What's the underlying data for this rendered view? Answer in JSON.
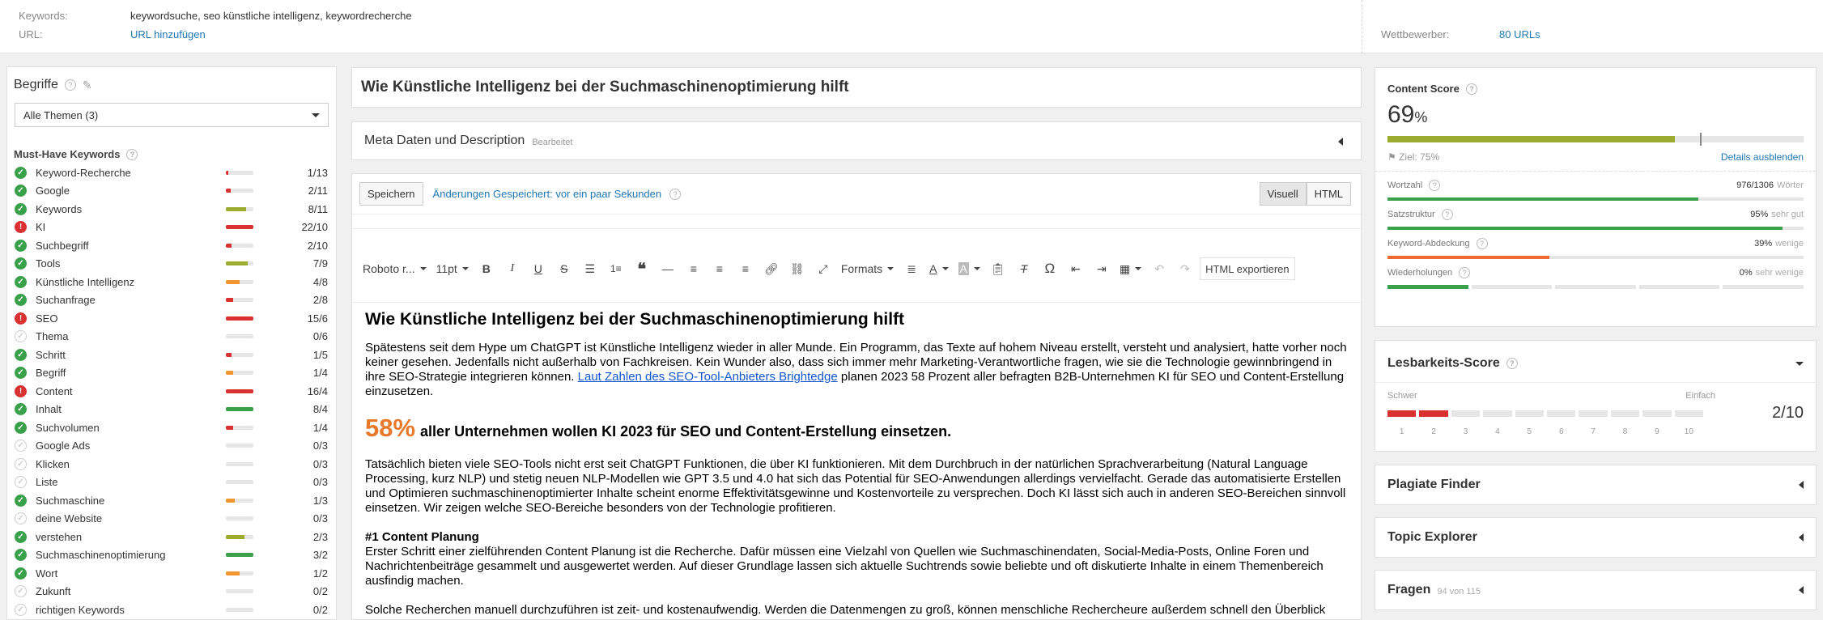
{
  "topbar": {
    "keywords_label": "Keywords:",
    "keywords_value": "keywordsuche, seo künstliche intelligenz, keywordrecherche",
    "url_label": "URL:",
    "url_link": "URL hinzufügen",
    "competitors_label": "Wettbewerber:",
    "competitors_link": "80 URLs"
  },
  "terms": {
    "title": "Begriffe",
    "filter_value": "Alle Themen (3)",
    "musthave_title": "Must-Have Keywords",
    "items": [
      {
        "name": "Keyword-Recherche",
        "count": "1/13",
        "status": "ok",
        "fill": 0.08,
        "color": "#d93030"
      },
      {
        "name": "Google",
        "count": "2/11",
        "status": "ok",
        "fill": 0.18,
        "color": "#d93030"
      },
      {
        "name": "Keywords",
        "count": "8/11",
        "status": "ok",
        "fill": 0.73,
        "color": "#9aab2f"
      },
      {
        "name": "KI",
        "count": "22/10",
        "status": "warn",
        "fill": 1.0,
        "color": "#d93030"
      },
      {
        "name": "Suchbegriff",
        "count": "2/10",
        "status": "ok",
        "fill": 0.2,
        "color": "#d93030"
      },
      {
        "name": "Tools",
        "count": "7/9",
        "status": "ok",
        "fill": 0.78,
        "color": "#9aab2f"
      },
      {
        "name": "Künstliche Intelligenz",
        "count": "4/8",
        "status": "ok",
        "fill": 0.5,
        "color": "#f0962e"
      },
      {
        "name": "Suchanfrage",
        "count": "2/8",
        "status": "ok",
        "fill": 0.25,
        "color": "#d93030"
      },
      {
        "name": "SEO",
        "count": "15/6",
        "status": "warn",
        "fill": 1.0,
        "color": "#d93030"
      },
      {
        "name": "Thema",
        "count": "0/6",
        "status": "none",
        "fill": 0,
        "color": "#d93030"
      },
      {
        "name": "Schritt",
        "count": "1/5",
        "status": "ok",
        "fill": 0.2,
        "color": "#d93030"
      },
      {
        "name": "Begriff",
        "count": "1/4",
        "status": "ok",
        "fill": 0.25,
        "color": "#f0962e"
      },
      {
        "name": "Content",
        "count": "16/4",
        "status": "warn",
        "fill": 1.0,
        "color": "#d93030"
      },
      {
        "name": "Inhalt",
        "count": "8/4",
        "status": "ok",
        "fill": 1.0,
        "color": "#3aa14b"
      },
      {
        "name": "Suchvolumen",
        "count": "1/4",
        "status": "ok",
        "fill": 0.25,
        "color": "#d93030"
      },
      {
        "name": "Google Ads",
        "count": "0/3",
        "status": "none",
        "fill": 0,
        "color": "#d93030"
      },
      {
        "name": "Klicken",
        "count": "0/3",
        "status": "none",
        "fill": 0,
        "color": "#d93030"
      },
      {
        "name": "Liste",
        "count": "0/3",
        "status": "none",
        "fill": 0,
        "color": "#d93030"
      },
      {
        "name": "Suchmaschine",
        "count": "1/3",
        "status": "ok",
        "fill": 0.33,
        "color": "#f0962e"
      },
      {
        "name": "deine Website",
        "count": "0/3",
        "status": "none",
        "fill": 0,
        "color": "#d93030"
      },
      {
        "name": "verstehen",
        "count": "2/3",
        "status": "ok",
        "fill": 0.67,
        "color": "#9aab2f"
      },
      {
        "name": "Suchmaschinenoptimierung",
        "count": "3/2",
        "status": "ok",
        "fill": 1.0,
        "color": "#3aa14b"
      },
      {
        "name": "Wort",
        "count": "1/2",
        "status": "ok",
        "fill": 0.5,
        "color": "#f0962e"
      },
      {
        "name": "Zukunft",
        "count": "0/2",
        "status": "none",
        "fill": 0,
        "color": "#d93030"
      },
      {
        "name": "richtigen Keywords",
        "count": "0/2",
        "status": "none",
        "fill": 0,
        "color": "#d93030"
      }
    ]
  },
  "editor": {
    "title": "Wie Künstliche Intelligenz bei der Suchmaschinenoptimierung hilft",
    "meta_title": "Meta Daten und Description",
    "meta_status": "Bearbeitet",
    "save_label": "Speichern",
    "saved_status": "Änderungen Gespeichert: vor ein paar Sekunden",
    "view_visual": "Visuell",
    "view_html": "HTML",
    "font_family": "Roboto r...",
    "font_size": "11pt",
    "formats_label": "Formats",
    "export_label": "HTML exportieren"
  },
  "doc": {
    "h1": "Wie Künstliche Intelligenz bei der Suchmaschinenoptimierung hilft",
    "p1_a": "Spätestens seit dem Hype um ChatGPT ist Künstliche Intelligenz wieder in aller Munde. Ein Programm, das Texte auf hohem Niveau erstellt, versteht und analysiert, hatte vorher noch keiner gesehen. Jedenfalls nicht außerhalb von Fachkreisen. Kein Wunder also, dass sich immer mehr Marketing-Verantwortliche fragen, wie sie die Technologie gewinnbringend in ihre SEO-Strategie integrieren können. ",
    "p1_link": "Laut Zahlen des SEO-Tool-Anbieters Brightedge",
    "p1_b": " planen 2023 58 Prozent aller befragten B2B-Unternehmen KI für SEO und Content-Erstellung einzusetzen.",
    "stat_value": "58%",
    "stat_text": "aller Unternehmen wollen KI 2023 für SEO und Content-Erstellung einsetzen.",
    "p2": "Tatsächlich bieten viele SEO-Tools nicht erst seit ChatGPT Funktionen, die über KI funktionieren. Mit dem Durchbruch in der natürlichen Sprachverarbeitung (Natural Language Processing, kurz NLP) und stetig neuen NLP-Modellen wie GPT 3.5 und 4.0 hat sich das Potential für SEO-Anwendungen allerdings vervielfacht. Gerade das automatisierte Erstellen und Optimieren suchmaschinenoptimierter Inhalte scheint enorme Effektivitätsgewinne und Kostenvorteile zu versprechen. Doch KI lässt sich auch in anderen SEO-Bereichen sinnvoll einsetzen. Wir zeigen welche SEO-Bereiche besonders von der Technologie profitieren.",
    "h3": "#1 Content Planung",
    "p3": "Erster Schritt einer zielführenden Content Planung ist die Recherche. Dafür müssen eine Vielzahl von Quellen wie Suchmaschinendaten, Social-Media-Posts, Online Foren und Nachrichtenbeiträge gesammelt und ausgewertet werden. Auf dieser Grundlage lassen sich aktuelle Suchtrends sowie beliebte und oft diskutierte Inhalte in einem Themenbereich ausfindig machen.",
    "p4": "Solche Recherchen manuell durchzuführen ist zeit- und kostenaufwendig. Werden die Datenmengen zu groß, können menschliche Rechercheure außerdem schnell den Überblick verlieren."
  },
  "score": {
    "title": "Content Score",
    "value": "69",
    "unit": "%",
    "fill": 0.69,
    "target_fill": 0.75,
    "bar_color": "#9aab2f",
    "goal": "Ziel: 75%",
    "details_link": "Details ausblenden",
    "metrics": [
      {
        "label": "Wortzahl",
        "value": "976/1306",
        "note": "Wörter",
        "fill": 0.747,
        "color": "#3aa14b",
        "type": "bar"
      },
      {
        "label": "Satzstruktur",
        "value": "95%",
        "note": "sehr gut",
        "fill": 0.95,
        "color": "#3aa14b",
        "type": "bar"
      },
      {
        "label": "Keyword-Abdeckung",
        "value": "39%",
        "note": "wenige",
        "fill": 0.39,
        "color": "#ee6a32",
        "type": "bar"
      },
      {
        "label": "Wiederholungen",
        "value": "0%",
        "note": "sehr wenige",
        "fill": 1,
        "color": "#3aa14b",
        "type": "seg"
      }
    ]
  },
  "readability": {
    "title": "Lesbarkeits-Score",
    "hard": "Schwer",
    "easy": "Einfach",
    "score": "2/10",
    "level": 2,
    "scale": [
      "1",
      "2",
      "3",
      "4",
      "5",
      "6",
      "7",
      "8",
      "9",
      "10"
    ],
    "color": "#d93030"
  },
  "cards": {
    "plagiarism": "Plagiate Finder",
    "topic": "Topic Explorer",
    "questions": "Fragen",
    "questions_sub": "94 von 115"
  }
}
